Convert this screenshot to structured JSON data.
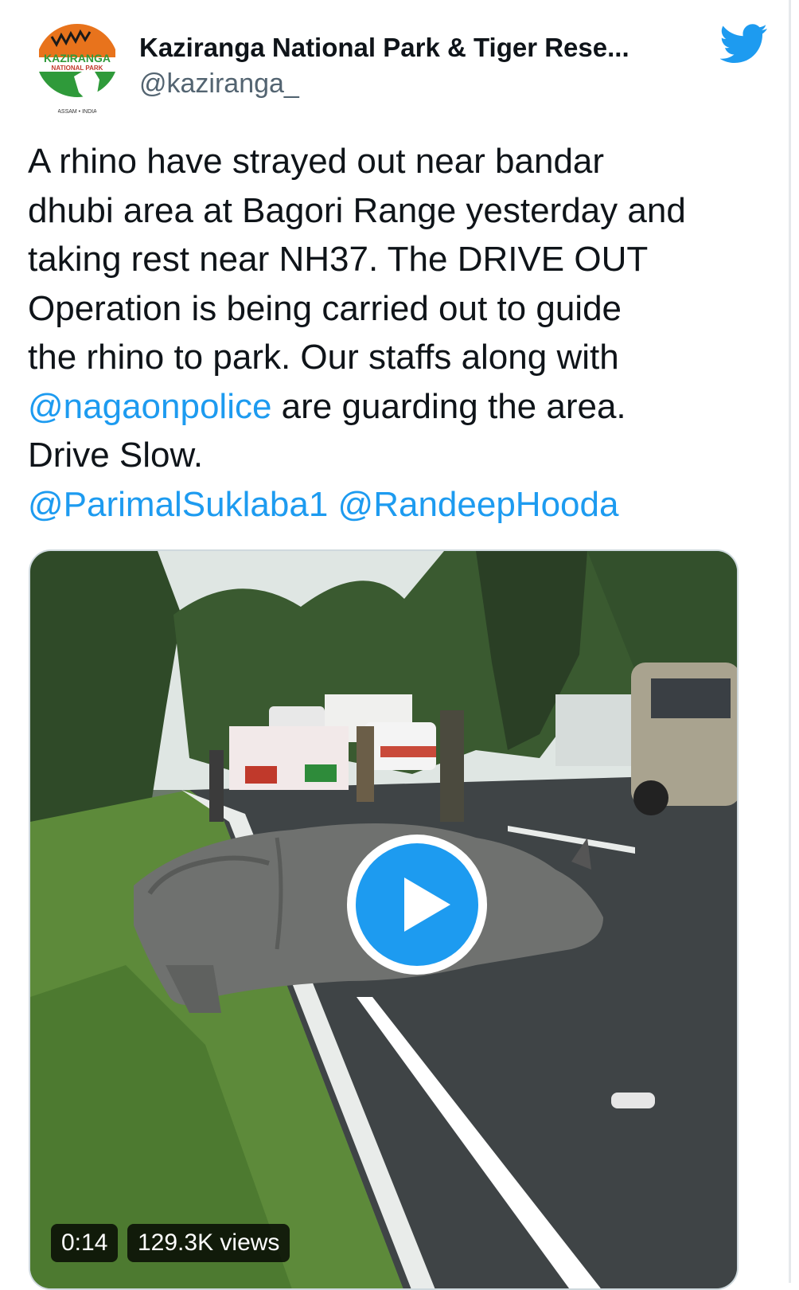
{
  "tweet": {
    "author": {
      "display_name": "Kaziranga National Park & Tiger Rese...",
      "handle": "@kaziranga_",
      "avatar_logo_text": "KAZIRANGA NATIONAL PARK ASSAM • INDIA",
      "verified_icon": "twitter-bird-icon"
    },
    "text": {
      "line1": "A rhino have strayed out near bandar",
      "line2": "dhubi area at Bagori Range yesterday and",
      "line3": "taking rest near NH37. The DRIVE OUT",
      "line4": "Operation is being carried out to guide",
      "line5": "the rhino to park. Our staffs along with",
      "mention1": "@nagaonpolice",
      "line6_rest": " are guarding the area.",
      "line7": "Drive Slow.",
      "mention2": "@ParimalSuklaba1",
      "mention3": "@RandeepHooda"
    },
    "media": {
      "duration": "0:14",
      "views": "129.3K views",
      "play_icon": "play-icon"
    }
  },
  "colors": {
    "link": "#1d9bf0",
    "text": "#0f1419",
    "secondary": "#536471",
    "play_button": "#1d9bf0"
  }
}
